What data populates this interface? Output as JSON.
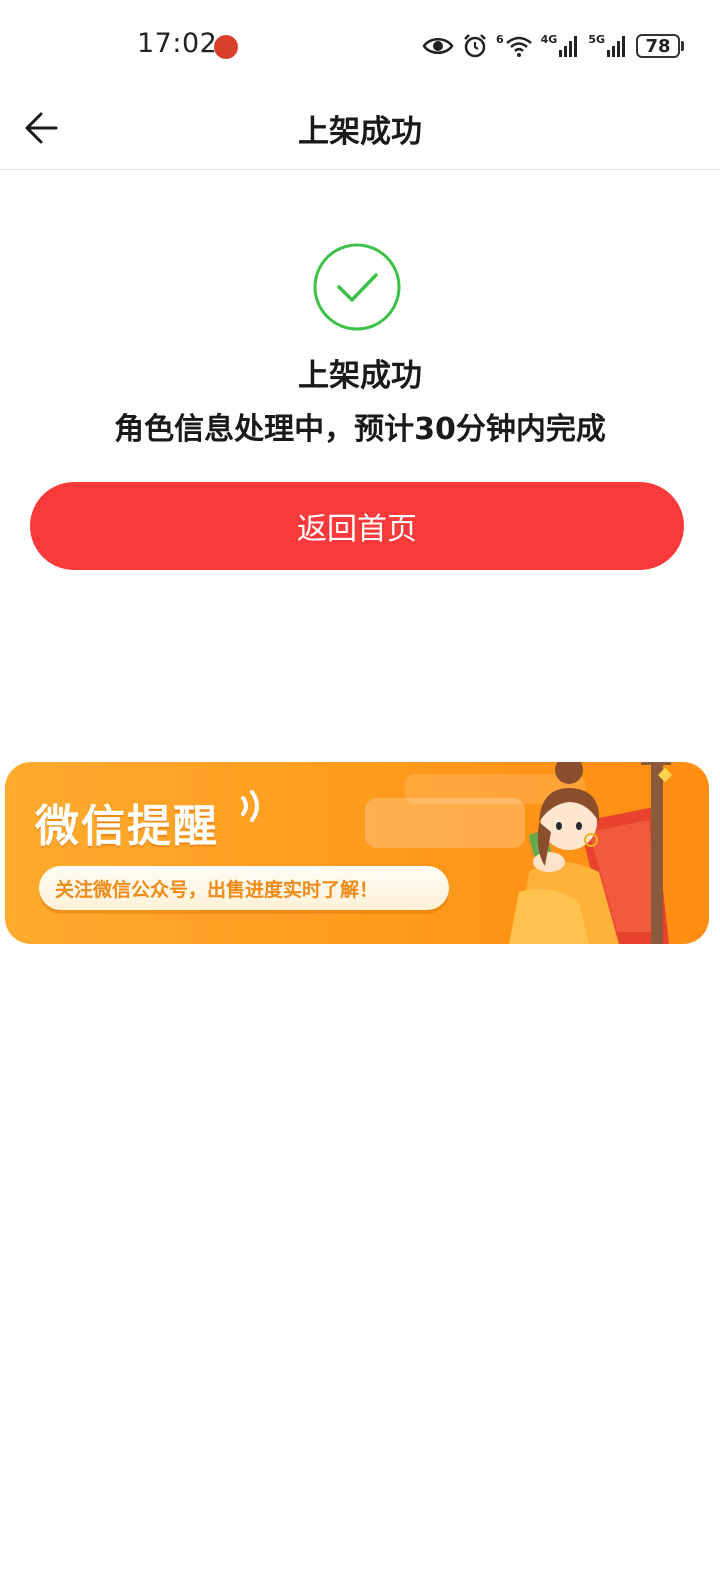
{
  "status_bar": {
    "time": "17:02",
    "network_1": "4G",
    "network_2": "5G",
    "wifi_label": "6",
    "battery": "78",
    "icons": [
      "huawei-dot-icon",
      "eye-icon",
      "alarm-icon",
      "wifi-icon",
      "signal-4g-icon",
      "signal-5g-icon",
      "battery-icon"
    ]
  },
  "nav": {
    "title": "上架成功",
    "back_icon": "arrow-left-icon"
  },
  "result": {
    "icon": "check-circle-icon",
    "title": "上架成功",
    "description": "角色信息处理中，预计30分钟内完成",
    "accent_color": "#3dc14a"
  },
  "actions": {
    "home_label": "返回首页",
    "button_color": "#f93a3a"
  },
  "banner": {
    "title": "微信提醒",
    "subtitle": "关注微信公众号，出售进度实时了解！",
    "colors": {
      "from": "#ffab2e",
      "to": "#ff8d12",
      "text": "#f08a16"
    }
  }
}
